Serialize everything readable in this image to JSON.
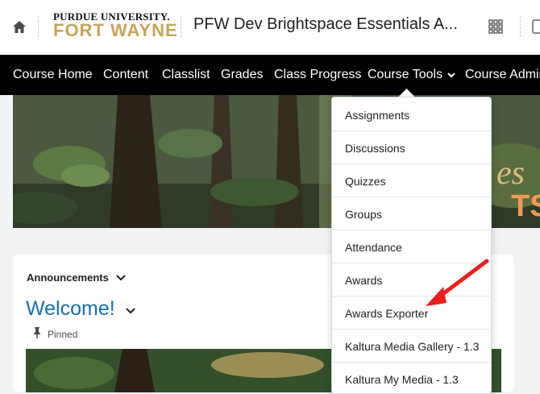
{
  "header": {
    "home_icon": "home-icon",
    "logo_line1": "PURDUE UNIVERSITY.",
    "logo_line2": "FORT WAYNE",
    "course_title": "PFW Dev Brightspace Essentials A...",
    "apps_icon": "grid-icon"
  },
  "navbar": {
    "items": [
      {
        "label": "Course Home"
      },
      {
        "label": "Content"
      },
      {
        "label": "Classlist"
      },
      {
        "label": "Grades"
      },
      {
        "label": "Class Progress"
      },
      {
        "label": "Course Tools"
      },
      {
        "label": "Course Admin"
      }
    ]
  },
  "dropdown": {
    "items": [
      {
        "label": "Assignments"
      },
      {
        "label": "Discussions"
      },
      {
        "label": "Quizzes"
      },
      {
        "label": "Groups"
      },
      {
        "label": "Attendance"
      },
      {
        "label": "Awards"
      },
      {
        "label": "Awards Exporter"
      },
      {
        "label": "Kaltura Media Gallery - 1.3"
      },
      {
        "label": "Kaltura My Media - 1.3"
      }
    ]
  },
  "announcements": {
    "label": "Announcements",
    "title": "Welcome!",
    "pinned": "Pinned"
  },
  "colors": {
    "navbar_bg": "#000000",
    "link_blue": "#1b6fa8",
    "gold": "#c9a35a",
    "annotation_arrow": "#e8221b"
  }
}
